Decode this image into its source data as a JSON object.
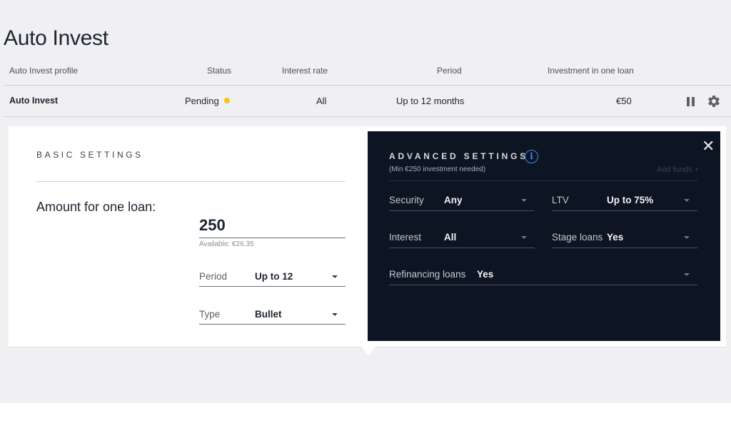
{
  "page": {
    "title": "Auto Invest"
  },
  "table": {
    "headers": [
      "Auto Invest profile",
      "Status",
      "Interest rate",
      "Period",
      "Investment in one loan"
    ],
    "row": {
      "profile": "Auto Invest",
      "status": "Pending",
      "interest_rate": "All",
      "period": "Up to 12 months",
      "investment": "€50"
    },
    "status_color": "#f5c518",
    "actions": [
      "pause-icon",
      "gear-icon"
    ]
  },
  "basic_settings": {
    "heading": "BASIC SETTINGS",
    "amount_label": "Amount for one loan:",
    "amount_value": "250",
    "available": "Available: €26.35",
    "period": {
      "label": "Period",
      "value": "Up to 12"
    },
    "type": {
      "label": "Type",
      "value": "Bullet"
    }
  },
  "advanced_settings": {
    "heading": "ADVANCED SETTINGS",
    "subtitle": "(Min €250 investment needed)",
    "add_funds": "Add funds +",
    "fields": {
      "security": {
        "label": "Security",
        "value": "Any"
      },
      "ltv": {
        "label": "LTV",
        "value": "Up to 75%"
      },
      "interest": {
        "label": "Interest",
        "value": "All"
      },
      "stage_loans": {
        "label": "Stage loans",
        "value": "Yes"
      },
      "refinancing": {
        "label": "Refinancing loans",
        "value": "Yes"
      }
    },
    "info_icon": "i",
    "close_icon": "✕",
    "panel_color": "#0d1422",
    "accent_color": "#3d8ef0"
  }
}
